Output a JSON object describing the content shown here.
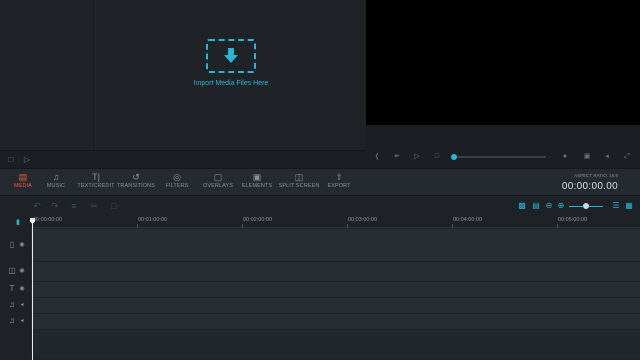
{
  "media": {
    "import_label": "Import Media Files Here",
    "icon": "download-arrow-icon"
  },
  "toolbar": {
    "tools": [
      {
        "label": "MEDIA",
        "icon": "folder-icon",
        "active": true
      },
      {
        "label": "MUSIC",
        "icon": "music-note-icon",
        "active": false
      },
      {
        "label": "TEXT/CREDIT",
        "icon": "text-icon",
        "active": false
      },
      {
        "label": "TRANSITIONS",
        "icon": "transition-icon",
        "active": false
      },
      {
        "label": "FILTERS",
        "icon": "filters-icon",
        "active": false
      },
      {
        "label": "OVERLAYS",
        "icon": "overlays-icon",
        "active": false
      },
      {
        "label": "ELEMENTS",
        "icon": "image-icon",
        "active": false
      },
      {
        "label": "SPLIT SCREEN",
        "icon": "split-screen-icon",
        "active": false
      },
      {
        "label": "EXPORT",
        "icon": "export-icon",
        "active": false
      }
    ],
    "aspect_ratio": "ASPECT RATIO: 16:9",
    "timecode": "00:00:00.00"
  },
  "timeline": {
    "ruler": [
      "00:00:00:00",
      "00:01:00:00",
      "00:02:00:00",
      "00:03:00:00",
      "00:04:00:00",
      "00:05:00:00"
    ],
    "tracks": [
      {
        "icon": "video-track-icon"
      },
      {
        "icon": "pip-track-icon"
      },
      {
        "icon": "text-track-icon"
      },
      {
        "icon": "audio-track-icon"
      },
      {
        "icon": "audio-track-icon"
      }
    ]
  },
  "colors": {
    "accent": "#27b5d6",
    "active_tab": "#ef5a34"
  }
}
